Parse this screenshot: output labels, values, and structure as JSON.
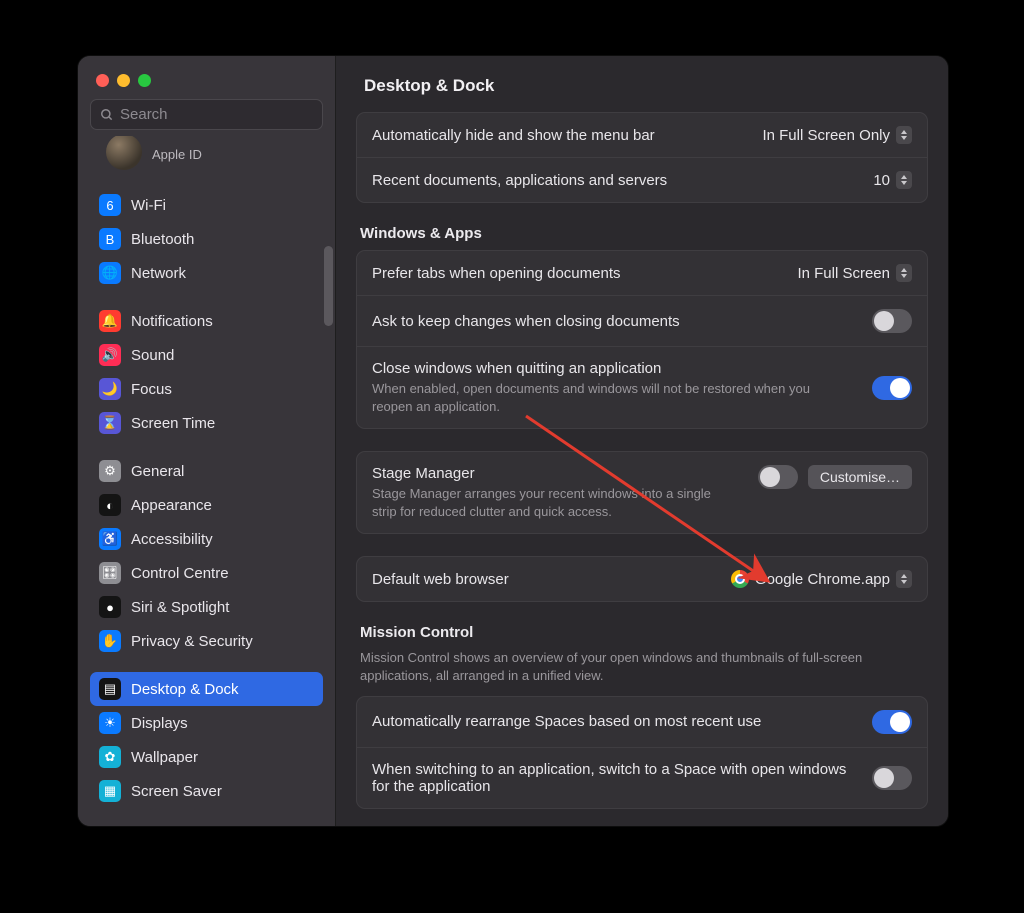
{
  "window": {
    "title": "Desktop & Dock"
  },
  "search": {
    "placeholder": "Search"
  },
  "apple_id": {
    "label": "Apple ID"
  },
  "sidebar": {
    "groups": [
      [
        {
          "label": "Wi-Fi",
          "icon": "wifi-icon",
          "bg": "#0a7aff"
        },
        {
          "label": "Bluetooth",
          "icon": "bluetooth-icon",
          "bg": "#0a7aff"
        },
        {
          "label": "Network",
          "icon": "network-icon",
          "bg": "#0a7aff"
        }
      ],
      [
        {
          "label": "Notifications",
          "icon": "bell-icon",
          "bg": "#ff3b30"
        },
        {
          "label": "Sound",
          "icon": "speaker-icon",
          "bg": "#ff2d55"
        },
        {
          "label": "Focus",
          "icon": "moon-icon",
          "bg": "#5856d6"
        },
        {
          "label": "Screen Time",
          "icon": "hourglass-icon",
          "bg": "#5856d6"
        }
      ],
      [
        {
          "label": "General",
          "icon": "gear-icon",
          "bg": "#8e8e93"
        },
        {
          "label": "Appearance",
          "icon": "appearance-icon",
          "bg": "#141414"
        },
        {
          "label": "Accessibility",
          "icon": "accessibility-icon",
          "bg": "#0a7aff"
        },
        {
          "label": "Control Centre",
          "icon": "switches-icon",
          "bg": "#8e8e93"
        },
        {
          "label": "Siri & Spotlight",
          "icon": "siri-icon",
          "bg": "#141414"
        },
        {
          "label": "Privacy & Security",
          "icon": "hand-icon",
          "bg": "#0a7aff"
        }
      ],
      [
        {
          "label": "Desktop & Dock",
          "icon": "dock-icon",
          "bg": "#141414",
          "selected": true
        },
        {
          "label": "Displays",
          "icon": "displays-icon",
          "bg": "#0a7aff"
        },
        {
          "label": "Wallpaper",
          "icon": "wallpaper-icon",
          "bg": "#14b1d6"
        },
        {
          "label": "Screen Saver",
          "icon": "screensaver-icon",
          "bg": "#14b1d6"
        }
      ]
    ]
  },
  "top_panel": {
    "menubar": {
      "label": "Automatically hide and show the menu bar",
      "value": "In Full Screen Only"
    },
    "recent": {
      "label": "Recent documents, applications and servers",
      "value": "10"
    }
  },
  "windows_apps": {
    "heading": "Windows & Apps",
    "prefer_tabs": {
      "label": "Prefer tabs when opening documents",
      "value": "In Full Screen"
    },
    "ask_keep": {
      "label": "Ask to keep changes when closing documents",
      "on": false
    },
    "close_win": {
      "label": "Close windows when quitting an application",
      "desc": "When enabled, open documents and windows will not be restored when you reopen an application.",
      "on": true
    }
  },
  "stage": {
    "label": "Stage Manager",
    "desc": "Stage Manager arranges your recent windows into a single strip for reduced clutter and quick access.",
    "on": false,
    "customise": "Customise…"
  },
  "browser": {
    "label": "Default web browser",
    "value": "Google Chrome.app"
  },
  "mission": {
    "heading": "Mission Control",
    "desc": "Mission Control shows an overview of your open windows and thumbnails of full-screen applications, all arranged in a unified view.",
    "auto_rearrange": {
      "label": "Automatically rearrange Spaces based on most recent use",
      "on": true
    },
    "switch_space": {
      "label": "When switching to an application, switch to a Space with open windows for the application",
      "on": false
    }
  }
}
